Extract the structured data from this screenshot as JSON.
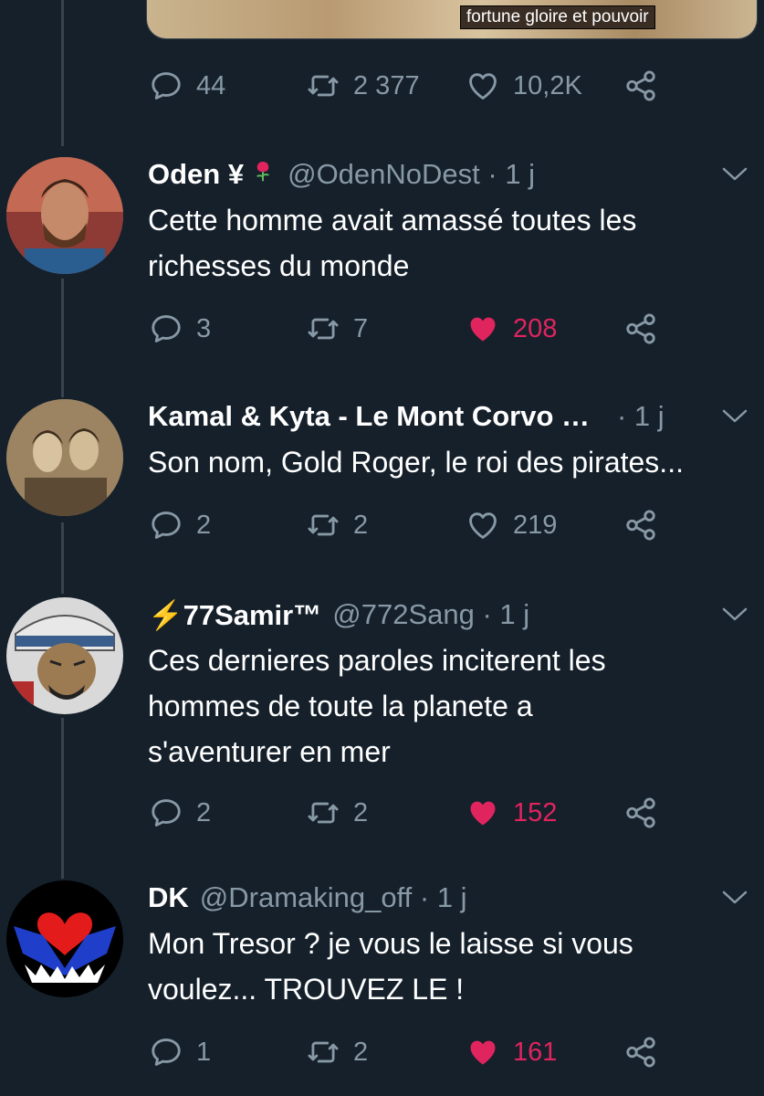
{
  "top_media": {
    "caption": "fortune gloire et pouvoir"
  },
  "top_actions": {
    "replies": "44",
    "retweets": "2 377",
    "likes": "10,2K",
    "liked": false
  },
  "tweets": [
    {
      "name": "Oden ¥",
      "handle": "@OdenNoDest · 1 j",
      "text_lines": [
        "Cette homme avait amassé toutes les",
        "richesses du monde"
      ],
      "replies": "3",
      "retweets": "7",
      "likes": "208",
      "liked": true
    },
    {
      "name": "Kamal & Kyta - Le Mont Corvo …",
      "handle": "· 1 j",
      "text_lines": [
        "Son nom, Gold Roger, le roi des pirates..."
      ],
      "replies": "2",
      "retweets": "2",
      "likes": "219",
      "liked": false
    },
    {
      "name": "⚡77Samir™",
      "handle": "@772Sang · 1 j",
      "text_lines": [
        "Ces dernieres paroles inciterent les",
        "hommes de toute la planete a",
        "s'aventurer en mer"
      ],
      "replies": "2",
      "retweets": "2",
      "likes": "152",
      "liked": true
    },
    {
      "name": "DK",
      "handle": "@Dramaking_off · 1 j",
      "text_lines": [
        "Mon Tresor ? je vous le laisse si vous",
        "voulez... TROUVEZ LE !"
      ],
      "replies": "1",
      "retweets": "2",
      "likes": "161",
      "liked": true
    }
  ],
  "colors": {
    "background": "#15202b",
    "muted": "#8899a6",
    "like": "#e0245e",
    "line": "#38444d"
  }
}
